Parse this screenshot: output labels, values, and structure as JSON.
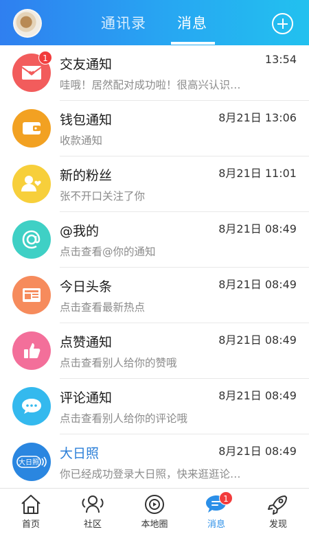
{
  "header": {
    "tabs": [
      {
        "label": "通讯录",
        "active": false
      },
      {
        "label": "消息",
        "active": true
      }
    ]
  },
  "messages": [
    {
      "title": "交友通知",
      "subtitle": "哇哦！居然配对成功啦！很高兴认识…",
      "time": "13:54",
      "badge": "1",
      "icon": "envelope-icon",
      "color": "#f25c5c"
    },
    {
      "title": "钱包通知",
      "subtitle": "收款通知",
      "time": "8月21日 13:06",
      "icon": "wallet-icon",
      "color": "#f2a122"
    },
    {
      "title": "新的粉丝",
      "subtitle": "张不开口关注了你",
      "time": "8月21日 11:01",
      "icon": "new-follower-icon",
      "color": "#f7cf3b"
    },
    {
      "title": "@我的",
      "subtitle": "点击查看@你的通知",
      "time": "8月21日 08:49",
      "icon": "at-mention-icon",
      "color": "#3fd0c5"
    },
    {
      "title": "今日头条",
      "subtitle": "点击查看最新热点",
      "time": "8月21日 08:49",
      "icon": "newspaper-icon",
      "color": "#f68b5c"
    },
    {
      "title": "点赞通知",
      "subtitle": "点击查看别人给你的赞哦",
      "time": "8月21日 08:49",
      "icon": "thumbs-up-icon",
      "color": "#f36f9a"
    },
    {
      "title": "评论通知",
      "subtitle": "点击查看别人给你的评论哦",
      "time": "8月21日 08:49",
      "icon": "comment-icon",
      "color": "#34b9ee"
    },
    {
      "title": "大日照",
      "subtitle": "你已经成功登录大日照，快来逛逛论…",
      "time": "8月21日 08:49",
      "icon": "da-rizhao-logo-icon",
      "logo_text": "大日照",
      "color": "#2a86e0"
    }
  ],
  "bottom_nav": [
    {
      "label": "首页",
      "icon": "home-icon",
      "active": false
    },
    {
      "label": "社区",
      "icon": "community-icon",
      "active": false
    },
    {
      "label": "本地圈",
      "icon": "local-circle-icon",
      "active": false
    },
    {
      "label": "消息",
      "icon": "message-icon",
      "active": true,
      "badge": "1"
    },
    {
      "label": "发现",
      "icon": "rocket-icon",
      "active": false
    }
  ]
}
